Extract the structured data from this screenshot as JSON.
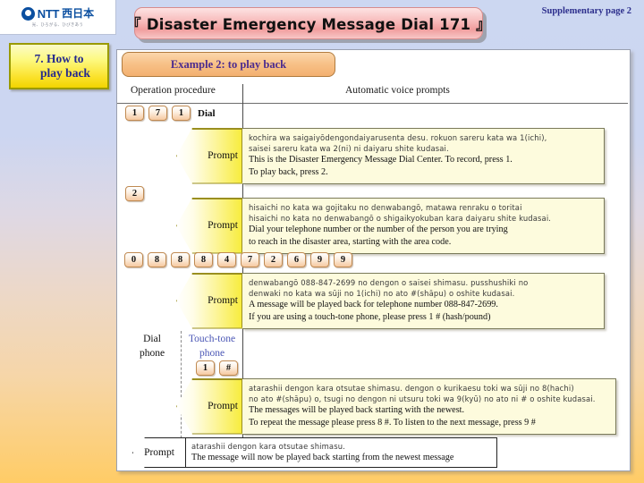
{
  "brand": {
    "name": "NTT",
    "region_jp": "西日本",
    "tagline_jp": "光、ひろがる、ひびきあう"
  },
  "section_chip": {
    "line1": "7. How to",
    "line2": "play back"
  },
  "supplementary_page": "Supplementary page 2",
  "title": "『 Disaster Emergency Message Dial 171 』",
  "example_header": "Example 2: to play back",
  "columns": {
    "left": "Operation procedure",
    "right": "Automatic voice prompts"
  },
  "prompt_label": "Prompt",
  "steps": [
    {
      "keys": [
        "1",
        "7",
        "1"
      ],
      "key_after_label": "Dial",
      "prompt": {
        "jp": [
          "kochira wa saigaiyōdengondaiyarusenta desu. rokuon sareru kata wa 1(ichi),",
          "saisei sareru kata wa 2(ni) ni daiyaru shite kudasai."
        ],
        "en": [
          "This is the Disaster Emergency Message Dial Center. To record, press 1.",
          "To play back, press 2."
        ]
      }
    },
    {
      "keys": [
        "2"
      ],
      "key_after_label": "",
      "prompt": {
        "jp": [
          "hisaichi no kata wa gojitaku no denwabangō, matawa renraku o toritai",
          "hisaichi no kata no denwabangō o shigaikyokuban kara daiyaru shite kudasai."
        ],
        "en": [
          "Dial your telephone number or the number of the person you are trying",
          "to reach in the disaster area, starting with the area code."
        ]
      }
    },
    {
      "keys": [
        "0",
        "8",
        "8",
        "8",
        "4",
        "7",
        "2",
        "6",
        "9",
        "9"
      ],
      "key_after_label": "",
      "prompt": {
        "jp": [
          "denwabangō 088-847-2699 no dengon o saisei shimasu. pusshushiki no",
          "denwaki no kata wa sūji no 1(ichi) no ato #(shāpu) o oshite kudasai."
        ],
        "en": [
          "A message will be played back for telephone number 088-847-2699.",
          "If you are using a touch-tone phone, please press 1 # (hash/pound)"
        ]
      }
    }
  ],
  "phone_types": {
    "dial": "Dial\nphone",
    "dial_line1": "Dial",
    "dial_line2": "phone",
    "touch_tone_line1": "Touch-tone",
    "touch_tone_line2": "phone",
    "touch_tone_keys": [
      "1",
      "#"
    ]
  },
  "touch_tone_prompt": {
    "jp": [
      "atarashii dengon kara otsutae shimasu. dengon o kurikaesu toki wa sūji no 8(hachi)",
      "no ato #(shāpu) o, tsugi no dengon ni utsuru toki wa 9(kyū) no ato ni # o oshite kudasai."
    ],
    "en": [
      "The messages will be played back starting with the newest.",
      "To repeat the message please press 8 #. To listen to the next message, press 9 #"
    ]
  },
  "final_prompt": {
    "label": "Prompt",
    "jp": "atarashii dengon kara otsutae shimasu.",
    "en": "The message will now be played back starting from the newest message"
  },
  "colors": {
    "title_band": "#f7b9b9",
    "chip_yellow": "#fbe22c",
    "example_orange": "#f7c086",
    "prompt_box": "#fdfbdd",
    "accent_purple": "#4b2b8f",
    "bg_top": "#ccd7f1",
    "bg_bottom": "#ffcc66"
  }
}
